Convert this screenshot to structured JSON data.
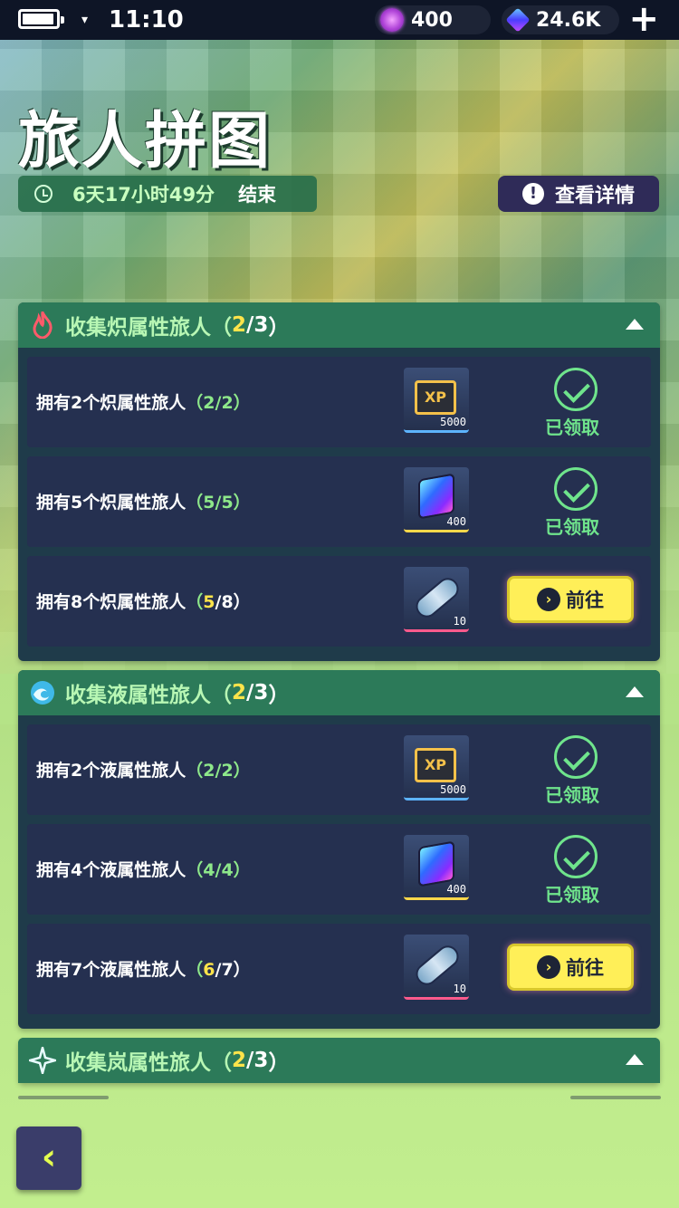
{
  "status_bar": {
    "time": "11:10",
    "dropdown_glyph": "▾",
    "currency_orb": "400",
    "currency_cube": "24.6K",
    "plus": "+"
  },
  "header": {
    "title": "旅人拼图",
    "timer": {
      "time": "6天17小时49分",
      "suffix": "结束"
    },
    "details_button": "查看详情",
    "details_icon": "!"
  },
  "sections": [
    {
      "title": "收集炽属性旅人",
      "count_open": "（",
      "count_current": "2",
      "count_sep": "/",
      "count_total": "3",
      "count_close": "）",
      "icon": "flame-icon",
      "tasks": [
        {
          "label": "拥有2个炽属性旅人",
          "p_open": "（",
          "p_cur": "2",
          "p_sep": "/",
          "p_tot": "2",
          "p_close": "）",
          "reward": "xp",
          "reward_label": "XP",
          "qty": "5000",
          "status": "claimed",
          "status_text": "已领取"
        },
        {
          "label": "拥有5个炽属性旅人",
          "p_open": "（",
          "p_cur": "5",
          "p_sep": "/",
          "p_tot": "5",
          "p_close": "）",
          "reward": "cube",
          "qty": "400",
          "status": "claimed",
          "status_text": "已领取"
        },
        {
          "label": "拥有8个炽属性旅人",
          "p_open": "（",
          "p_cur": "5",
          "p_sep": "/",
          "p_tot": "8",
          "p_close": "）",
          "reward": "ticket",
          "qty": "10",
          "status": "goto",
          "status_text": "前往"
        }
      ]
    },
    {
      "title": "收集液属性旅人",
      "count_open": "（",
      "count_current": "2",
      "count_sep": "/",
      "count_total": "3",
      "count_close": "）",
      "icon": "wave-icon",
      "tasks": [
        {
          "label": "拥有2个液属性旅人",
          "p_open": "（",
          "p_cur": "2",
          "p_sep": "/",
          "p_tot": "2",
          "p_close": "）",
          "reward": "xp",
          "reward_label": "XP",
          "qty": "5000",
          "status": "claimed",
          "status_text": "已领取"
        },
        {
          "label": "拥有4个液属性旅人",
          "p_open": "（",
          "p_cur": "4",
          "p_sep": "/",
          "p_tot": "4",
          "p_close": "）",
          "reward": "cube",
          "qty": "400",
          "status": "claimed",
          "status_text": "已领取"
        },
        {
          "label": "拥有7个液属性旅人",
          "p_open": "（",
          "p_cur": "6",
          "p_sep": "/",
          "p_tot": "7",
          "p_close": "）",
          "reward": "ticket",
          "qty": "10",
          "status": "goto",
          "status_text": "前往"
        }
      ]
    },
    {
      "title": "收集岚属性旅人",
      "count_open": "（",
      "count_current": "2",
      "count_sep": "/",
      "count_total": "3",
      "count_close": "）",
      "icon": "star-wind-icon"
    }
  ],
  "back_button": "‹",
  "colors": {
    "accent_yellow": "#ffe44a",
    "claimed_green": "#6fe48c",
    "header_green": "#2c7a59"
  }
}
